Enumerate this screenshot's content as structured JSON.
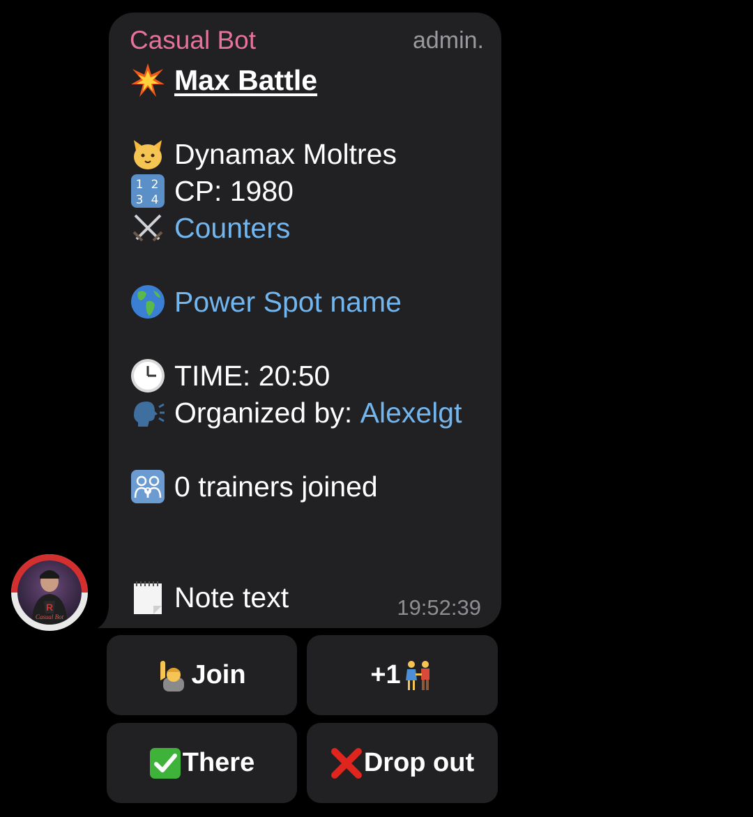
{
  "message": {
    "sender": "Casual Bot",
    "role_tag": "admin.",
    "title": "Max Battle",
    "pokemon": "Dynamax Moltres",
    "cp_label": "CP: 1980",
    "counters_link": "Counters",
    "location_link": "Power Spot name",
    "time_label": "TIME: 20:50",
    "organizer_prefix": "Organized by: ",
    "organizer_link": "Alexelgt",
    "trainers_joined": "0 trainers joined",
    "note": "Note text",
    "timestamp": "19:52:39"
  },
  "avatar": {
    "label": "Casual Bot"
  },
  "buttons": {
    "join": "Join",
    "plus_one": "+1",
    "there": "There",
    "drop_out": "Drop out"
  },
  "icons": {
    "title": "collision-icon",
    "pokemon": "cat-face-icon",
    "cp": "numbers-1234-icon",
    "counters": "crossed-swords-icon",
    "location": "globe-icon",
    "time": "clock-icon",
    "organizer": "speaking-head-icon",
    "trainers": "family-icon",
    "note": "notepad-icon",
    "join": "raising-hand-icon",
    "plus_one": "couple-icon",
    "there": "check-mark-icon",
    "drop_out": "cross-mark-icon"
  },
  "colors": {
    "background": "#000000",
    "bubble": "#212123",
    "sender": "#e8739a",
    "link": "#72b6f0",
    "meta": "#9a9a9e"
  }
}
